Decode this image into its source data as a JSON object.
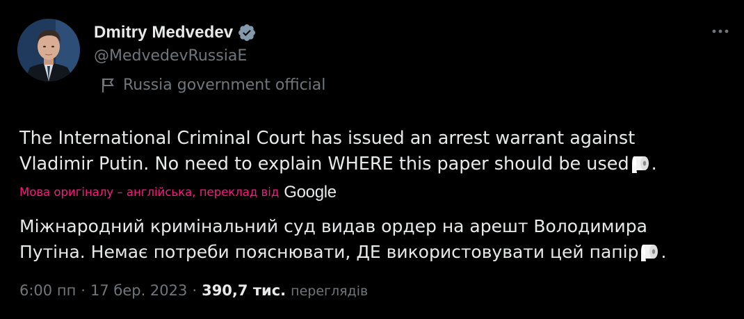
{
  "author": {
    "display_name": "Dmitry Medvedev",
    "handle": "@MedvedevRussiaE",
    "verified_badge": "verified-badge-icon",
    "affiliation_label": "Russia government official",
    "affiliation_icon": "government-flag-icon"
  },
  "tweet": {
    "text_line_1": "The International Criminal Court has issued an arrest warrant against",
    "text_line_2": "Vladimir Putin. No need to explain WHERE this paper should be used",
    "text_end": ".",
    "emoji_icon": "toilet-paper-icon"
  },
  "translation": {
    "note": "Мова оригіналу – англійська, переклад від",
    "provider": "Google",
    "text_line_1": "Міжнародний кримінальний суд видав ордер на арешт Володимира",
    "text_line_2": "Путіна. Немає потреби пояснювати, ДЕ використовувати цей папір",
    "text_end": "."
  },
  "meta": {
    "time": "6:00 пп",
    "separator": "·",
    "date": "17 бер. 2023",
    "views_count": "390,7 тис.",
    "views_label": "переглядів"
  },
  "colors": {
    "background": "#000000",
    "primary_text": "#e7e9ea",
    "secondary_text": "#71767b",
    "translation_accent": "#f91880",
    "verified_badge": "#829aab"
  }
}
